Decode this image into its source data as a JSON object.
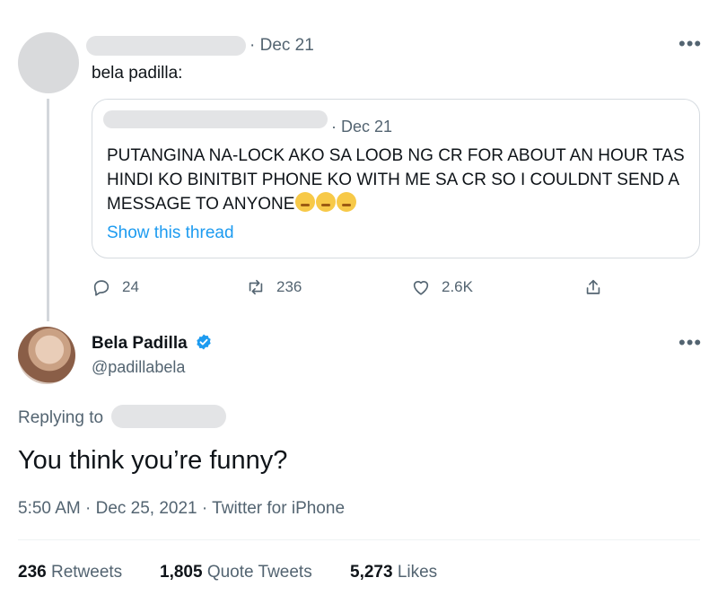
{
  "parent_tweet": {
    "date": "· Dec 21",
    "text": "bela padilla:",
    "quoted": {
      "date": "· Dec 21",
      "text": "PUTANGINA NA-LOCK AKO SA LOOB NG CR FOR ABOUT AN HOUR TAS HINDI KO BINITBIT PHONE KO WITH ME SA CR SO I COULDNT SEND A MESSAGE TO ANYONE",
      "show_thread": "Show this thread"
    },
    "actions": {
      "replies": "24",
      "retweets": "236",
      "likes": "2.6K"
    }
  },
  "main_tweet": {
    "name": "Bela Padilla",
    "handle": "@padillabela",
    "replying_to": "Replying to",
    "text": "You think you’re funny?",
    "meta": "5:50 AM · Dec 25, 2021 · Twitter for iPhone",
    "stats": {
      "retweets_count": "236",
      "retweets_label": "Retweets",
      "quotes_count": "1,805",
      "quotes_label": "Quote Tweets",
      "likes_count": "5,273",
      "likes_label": "Likes"
    }
  },
  "icons": [
    "more-icon",
    "reply-icon",
    "retweet-icon",
    "like-icon",
    "share-icon",
    "verified-icon"
  ],
  "colors": {
    "link": "#1d9bf0",
    "secondary": "#536471",
    "verified": "#1d9bf0"
  }
}
